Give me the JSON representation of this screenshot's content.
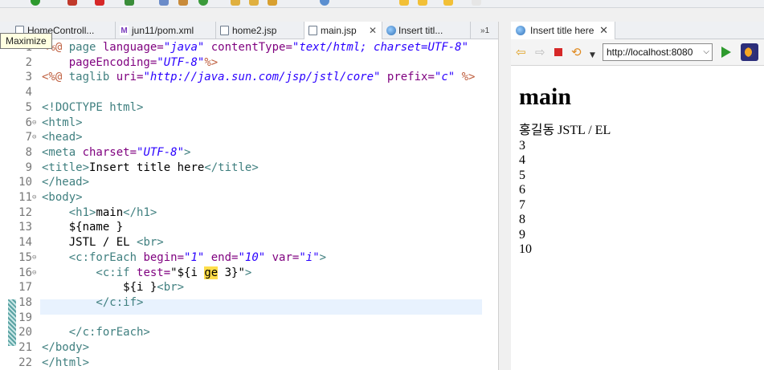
{
  "tooltip": "Maximize",
  "editor": {
    "tabs": [
      {
        "label": "HomeControll...",
        "icon": "java-file-icon"
      },
      {
        "label": "jun11/pom.xml",
        "icon": "maven-file-icon"
      },
      {
        "label": "home2.jsp",
        "icon": "jsp-file-icon"
      },
      {
        "label": "main.jsp",
        "icon": "jsp-file-icon",
        "active": true
      },
      {
        "label": "Insert titl...",
        "icon": "globe-icon"
      }
    ],
    "overflow_count": "1",
    "lines": [
      {
        "n": "1",
        "fold": ""
      },
      {
        "n": "2",
        "fold": ""
      },
      {
        "n": "3",
        "fold": ""
      },
      {
        "n": "4",
        "fold": ""
      },
      {
        "n": "5",
        "fold": ""
      },
      {
        "n": "6",
        "fold": "⊖"
      },
      {
        "n": "7",
        "fold": "⊖"
      },
      {
        "n": "8",
        "fold": ""
      },
      {
        "n": "9",
        "fold": ""
      },
      {
        "n": "10",
        "fold": ""
      },
      {
        "n": "11",
        "fold": "⊖"
      },
      {
        "n": "12",
        "fold": ""
      },
      {
        "n": "13",
        "fold": ""
      },
      {
        "n": "14",
        "fold": ""
      },
      {
        "n": "15",
        "fold": "⊖"
      },
      {
        "n": "16",
        "fold": "⊖"
      },
      {
        "n": "17",
        "fold": ""
      },
      {
        "n": "18",
        "fold": ""
      },
      {
        "n": "19",
        "fold": ""
      },
      {
        "n": "20",
        "fold": ""
      },
      {
        "n": "21",
        "fold": ""
      },
      {
        "n": "22",
        "fold": ""
      }
    ],
    "code": {
      "l1": {
        "a": "<%@ ",
        "b": "page ",
        "c": "language=",
        "d": "\"java\"",
        "e": " contentType=",
        "f": "\"text/html; charset=UTF-8\""
      },
      "l2": {
        "a": "    pageEncoding=",
        "b": "\"UTF-8\"",
        "c": "%>"
      },
      "l3": {
        "a": "<%@ ",
        "b": "taglib ",
        "c": "uri=",
        "d": "\"http://java.sun.com/jsp/jstl/core\"",
        "e": " prefix=",
        "f": "\"c\"",
        "g": " %>"
      },
      "l5": "<!DOCTYPE html>",
      "l6": "<html>",
      "l7": "<head>",
      "l8": {
        "a": "<meta ",
        "b": "charset=",
        "c": "\"UTF-8\"",
        "d": ">"
      },
      "l9": {
        "a": "<title>",
        "b": "Insert title here",
        "c": "</title>"
      },
      "l10": "</head>",
      "l11": "<body>",
      "l12": {
        "a": "    <h1>",
        "b": "main",
        "c": "</h1>"
      },
      "l13": "    ${name }",
      "l14": {
        "a": "    JSTL / EL ",
        "b": "<br>"
      },
      "l15": {
        "a": "    <c:forEach ",
        "b": "begin=",
        "c": "\"1\"",
        "d": " end=",
        "e": "\"10\"",
        "f": " var=",
        "g": "\"i\"",
        "h": ">"
      },
      "l16": {
        "a": "        <c:if ",
        "b": "test=",
        "c": "\"${i ",
        "d": "ge",
        "e": " 3}\"",
        "f": ">"
      },
      "l17": {
        "a": "            ${i }",
        "b": "<br>"
      },
      "l18": "        </c:if>",
      "l20": "    </c:forEach>",
      "l21": "</body>",
      "l22": "</html>"
    }
  },
  "browser": {
    "tab_label": "Insert title here",
    "url": "http://localhost:8080",
    "heading": "main",
    "output": [
      "홍길동 JSTL / EL",
      "3",
      "4",
      "5",
      "6",
      "7",
      "8",
      "9",
      "10"
    ]
  }
}
